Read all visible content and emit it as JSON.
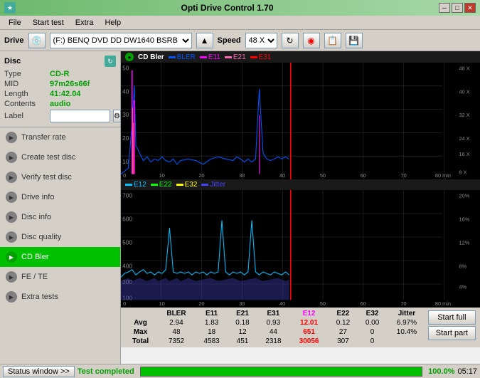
{
  "titlebar": {
    "title": "Opti Drive Control 1.70",
    "icon": "★",
    "btn_min": "─",
    "btn_max": "□",
    "btn_close": "✕"
  },
  "menubar": {
    "items": [
      "File",
      "Start test",
      "Extra",
      "Help"
    ]
  },
  "drivebar": {
    "drive_label": "Drive",
    "drive_value": "(F:)  BENQ DVD DD DW1640 BSRB",
    "speed_label": "Speed",
    "speed_value": "48 X"
  },
  "disc": {
    "title": "Disc",
    "type_label": "Type",
    "type_value": "CD-R",
    "mid_label": "MID",
    "mid_value": "97m26s66f",
    "length_label": "Length",
    "length_value": "41:42.04",
    "contents_label": "Contents",
    "contents_value": "audio",
    "label_label": "Label",
    "label_value": ""
  },
  "nav": {
    "items": [
      {
        "id": "transfer-rate",
        "label": "Transfer rate",
        "active": false
      },
      {
        "id": "create-test-disc",
        "label": "Create test disc",
        "active": false
      },
      {
        "id": "verify-test-disc",
        "label": "Verify test disc",
        "active": false
      },
      {
        "id": "drive-info",
        "label": "Drive info",
        "active": false
      },
      {
        "id": "disc-info",
        "label": "Disc info",
        "active": false
      },
      {
        "id": "disc-quality",
        "label": "Disc quality",
        "active": false
      },
      {
        "id": "cd-bler",
        "label": "CD Bler",
        "active": true
      },
      {
        "id": "fe-te",
        "label": "FE / TE",
        "active": false
      },
      {
        "id": "extra-tests",
        "label": "Extra tests",
        "active": false
      }
    ]
  },
  "chart": {
    "upper_title": "CD Bler",
    "upper_legend": [
      {
        "label": "BLER",
        "color": "#0055ff"
      },
      {
        "label": "E11",
        "color": "#ff00ff"
      },
      {
        "label": "E21",
        "color": "#ff69b4"
      },
      {
        "label": "E31",
        "color": "#ff0000"
      }
    ],
    "lower_legend": [
      {
        "label": "E12",
        "color": "#00c0ff"
      },
      {
        "label": "E22",
        "color": "#00ff00"
      },
      {
        "label": "E32",
        "color": "#ffff00"
      },
      {
        "label": "Jitter",
        "color": "#4444ff"
      }
    ],
    "upper_y_max": 50,
    "upper_right_labels": [
      "48 X",
      "40 X",
      "32 X",
      "24 X",
      "16 X",
      "8 X"
    ],
    "lower_y_max": 700,
    "lower_right_labels": [
      "20%",
      "16%",
      "12%",
      "8%",
      "4%"
    ],
    "x_labels": [
      "0",
      "10",
      "20",
      "30",
      "40",
      "50",
      "60",
      "70",
      "80 min"
    ]
  },
  "stats": {
    "headers": [
      "",
      "BLER",
      "E11",
      "E21",
      "E31",
      "E12",
      "E22",
      "E32",
      "Jitter"
    ],
    "rows": [
      {
        "label": "Avg",
        "values": [
          "2.94",
          "1.83",
          "0.18",
          "0.93",
          "12.01",
          "0.12",
          "0.00",
          "6.97%"
        ]
      },
      {
        "label": "Max",
        "values": [
          "48",
          "18",
          "12",
          "44",
          "651",
          "27",
          "0",
          "10.4%"
        ]
      },
      {
        "label": "Total",
        "values": [
          "7352",
          "4583",
          "451",
          "2318",
          "30056",
          "307",
          "0",
          ""
        ]
      }
    ],
    "start_full_label": "Start full",
    "start_part_label": "Start part"
  },
  "statusbar": {
    "window_btn": "Status window >>",
    "status_text": "Test completed",
    "progress": "100.0%",
    "time": "05:17"
  }
}
